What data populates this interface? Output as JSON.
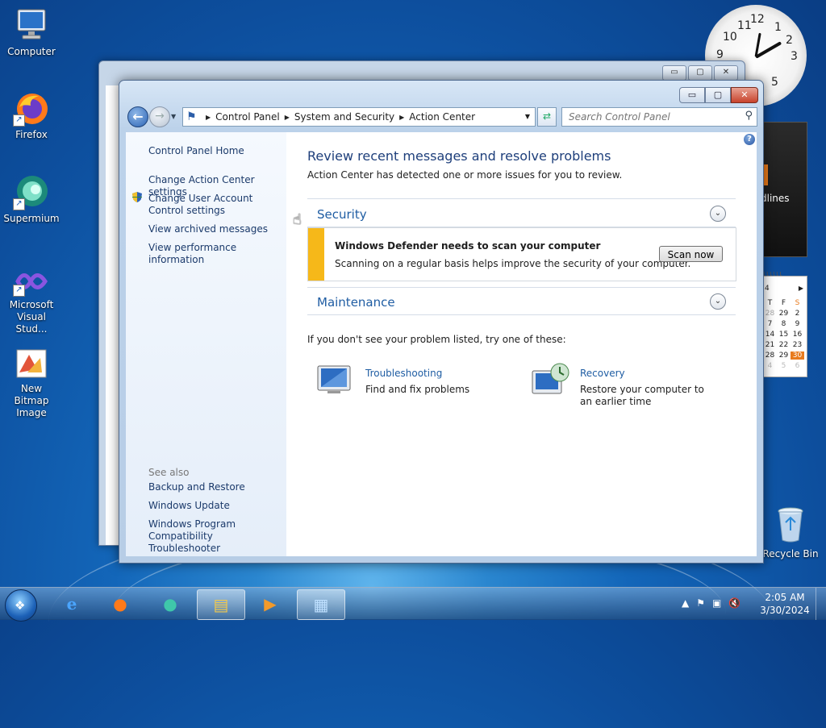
{
  "desktop": {
    "icons": [
      {
        "label": "Computer",
        "glyph": "computer-icon"
      },
      {
        "label": "Firefox",
        "glyph": "firefox-icon"
      },
      {
        "label": "Supermium",
        "glyph": "supermium-icon"
      },
      {
        "label": "Microsoft Visual Stud...",
        "glyph": "visual-studio-icon"
      },
      {
        "label": "New Bitmap Image",
        "glyph": "bitmap-image-icon"
      }
    ],
    "recycle_bin": "Recycle Bin",
    "gadget_headlines": "dlines"
  },
  "calendar": {
    "header": "4",
    "weekdays": [
      "T",
      "F",
      "S"
    ],
    "rows": [
      [
        "28",
        "29",
        "2"
      ],
      [
        "7",
        "8",
        "9"
      ],
      [
        "14",
        "15",
        "16"
      ],
      [
        "21",
        "22",
        "23"
      ],
      [
        "28",
        "29",
        "30"
      ],
      [
        "4",
        "5",
        "6"
      ]
    ],
    "today": "30",
    "accent": "#e87b1e"
  },
  "window": {
    "breadcrumb": [
      "Control Panel",
      "System and Security",
      "Action Center"
    ],
    "search_placeholder": "Search Control Panel",
    "buttons": {
      "minimize": "▭",
      "maximize": "▢",
      "close": "✕"
    }
  },
  "left_pane": {
    "home": "Control Panel Home",
    "links": [
      "Change Action Center settings",
      "Change User Account Control settings",
      "View archived messages",
      "View performance information"
    ],
    "see_also_label": "See also",
    "see_also": [
      "Backup and Restore",
      "Windows Update",
      "Windows Program Compatibility Troubleshooter"
    ]
  },
  "content": {
    "title": "Review recent messages and resolve problems",
    "subtitle": "Action Center has detected one or more issues for you to review.",
    "security_title": "Security",
    "alert_title": "Windows Defender needs to scan your computer",
    "alert_desc": "Scanning on a regular basis helps improve the security of your computer.",
    "alert_button": "Scan now",
    "alert_color": "#f6b819",
    "maintenance_title": "Maintenance",
    "try_text": "If you don't see your problem listed, try one of these:",
    "tools": [
      {
        "name": "Troubleshooting",
        "desc": "Find and fix problems"
      },
      {
        "name": "Recovery",
        "desc": "Restore your computer to an earlier time"
      }
    ]
  },
  "taskbar": {
    "time": "2:05 AM",
    "date": "3/30/2024"
  }
}
